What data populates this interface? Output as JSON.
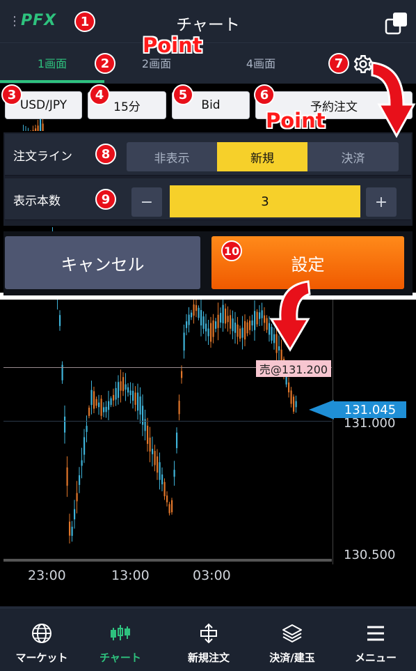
{
  "header": {
    "logo": "PFX",
    "title": "チャート",
    "menu_glyph": "⋮"
  },
  "tabs": [
    {
      "label": "1画面",
      "active": true
    },
    {
      "label": "2画面"
    },
    {
      "label": "4画面"
    }
  ],
  "toolbar": {
    "symbol": "USD/JPY",
    "timeframe": "15分",
    "price_type": "Bid",
    "order_btn": "予約注文"
  },
  "panel": {
    "order_line": {
      "label": "注文ライン",
      "options": [
        "非表示",
        "新規",
        "決済"
      ],
      "selected": "新規"
    },
    "display_count": {
      "label": "表示本数",
      "minus": "−",
      "value": "3",
      "plus": "+"
    }
  },
  "actions": {
    "cancel": "キャンセル",
    "confirm": "設定"
  },
  "annotations": {
    "badges": [
      "1",
      "2",
      "3",
      "4",
      "5",
      "6",
      "7",
      "8",
      "9",
      "10"
    ],
    "point": "Point"
  },
  "chart": {
    "order_label": "売@131.200",
    "current_price": "131.045",
    "y_ticks": [
      "131.000",
      "130.500"
    ],
    "x_ticks": [
      "23:00",
      "13:00",
      "03:00"
    ]
  },
  "nav": [
    {
      "label": "マーケット",
      "icon": "globe-icon"
    },
    {
      "label": "チャート",
      "icon": "candlestick-icon",
      "active": true
    },
    {
      "label": "新規注文",
      "icon": "new-order-icon"
    },
    {
      "label": "決済/建玉",
      "icon": "layers-icon"
    },
    {
      "label": "メニュー",
      "icon": "hamburger-icon"
    }
  ],
  "colors": {
    "accent": "#2ec27e",
    "yellow": "#f6d02a",
    "orange": "#f57a0c",
    "ask_blue": "#1f8fd6",
    "pink": "#f7c6d0",
    "annotation_red": "#e8101a"
  }
}
